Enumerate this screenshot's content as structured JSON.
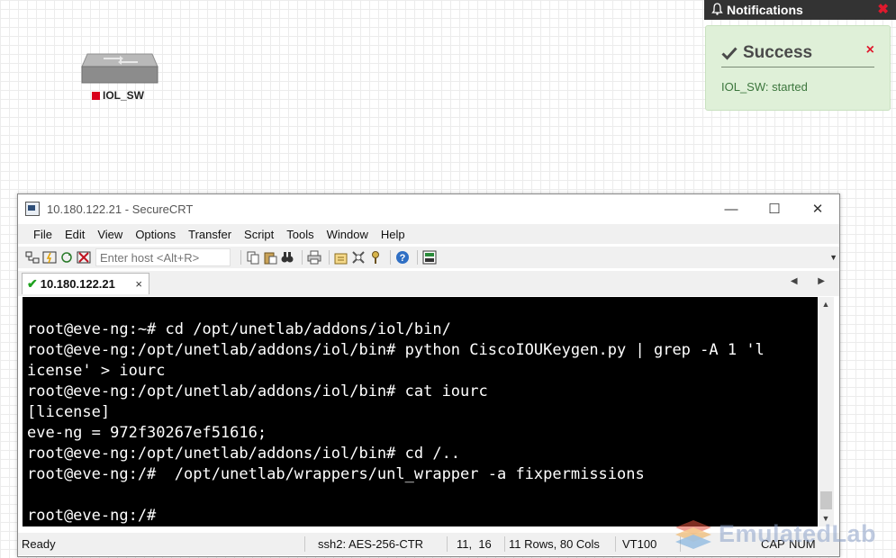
{
  "canvas": {
    "node": {
      "label": "IOL_SW",
      "status_color": "#d9001b"
    }
  },
  "notifications": {
    "title": "Notifications",
    "close": "✖",
    "toast": {
      "title": "Success",
      "message": "IOL_SW: started",
      "close": "×"
    }
  },
  "securecrt": {
    "title": "10.180.122.21 - SecureCRT",
    "window_controls": [
      "—",
      "☐",
      "✕"
    ],
    "menu": [
      "File",
      "Edit",
      "View",
      "Options",
      "Transfer",
      "Script",
      "Tools",
      "Window",
      "Help"
    ],
    "toolbar": {
      "quick_connect_placeholder": "Enter host <Alt+R>"
    },
    "tab": {
      "label": "10.180.122.21",
      "close": "×"
    },
    "tab_arrows": "◀ ▶",
    "terminal_lines": [
      "root@eve-ng:~# cd /opt/unetlab/addons/iol/bin/",
      "root@eve-ng:/opt/unetlab/addons/iol/bin# python CiscoIOUKeygen.py | grep -A 1 'l",
      "icense' > iourc",
      "root@eve-ng:/opt/unetlab/addons/iol/bin# cat iourc",
      "[license]",
      "eve-ng = 972f30267ef51616;",
      "root@eve-ng:/opt/unetlab/addons/iol/bin# cd /..",
      "root@eve-ng:/#  /opt/unetlab/wrappers/unl_wrapper -a fixpermissions",
      "",
      "root@eve-ng:/#"
    ],
    "status": {
      "ready": "Ready",
      "cipher": "ssh2: AES-256-CTR",
      "cursor": "11,  16",
      "size": "11 Rows, 80 Cols",
      "term": "VT100",
      "caps": "CAP",
      "num": "NUM"
    }
  },
  "watermark": {
    "text": "EmulatedLab"
  }
}
